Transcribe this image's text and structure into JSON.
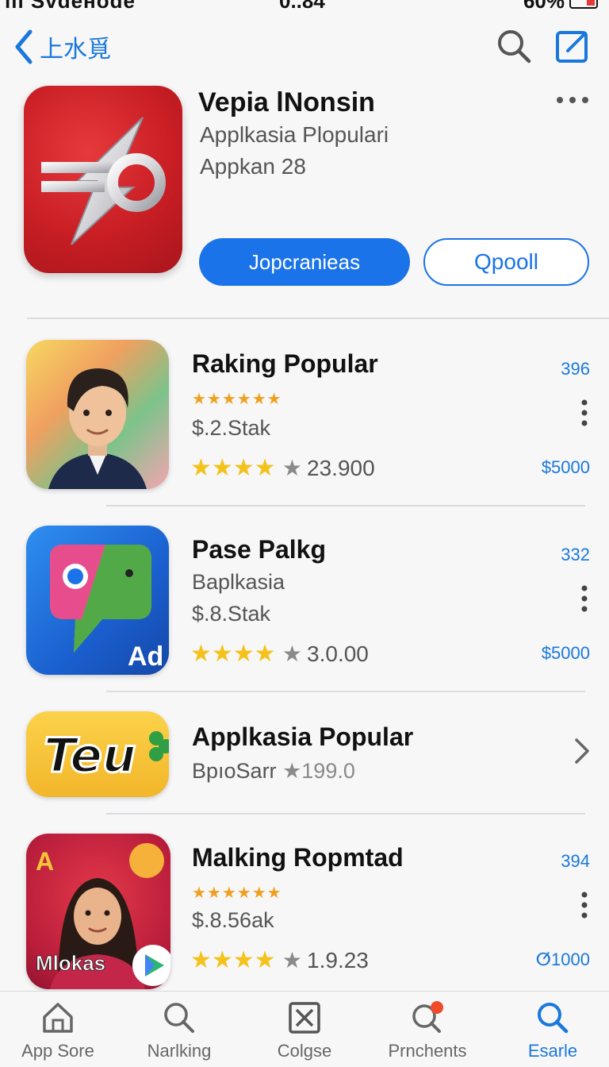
{
  "status_bar": {
    "carrier": "ııı Svdeнode",
    "time": "0..84",
    "battery_text": "60%"
  },
  "nav": {
    "back_label": "上水覓"
  },
  "featured": {
    "title": "Vepia lNonsin",
    "subtitle1": "Applkasia Plopulari",
    "subtitle2": "Appkan 28",
    "primary_button": "Jopcranieas",
    "secondary_button": "Qpooll"
  },
  "apps": [
    {
      "title": "Raking Popular",
      "small_stars": "★★★★★★",
      "price_line": "$.2.Stak",
      "stars": "★★★★",
      "rating_count": "23.900",
      "rank": "396",
      "price": "$5000"
    },
    {
      "title": "Pase Palkg",
      "category": "Baplkasia",
      "price_line": "$.8.Stak",
      "stars": "★★★★",
      "rating_count": "3.0.00",
      "rank": "332",
      "price": "$5000",
      "icon_badge": "Ad"
    },
    {
      "title": "Applkasia Popular",
      "category": "BpıoSarr",
      "rating": "★199.0",
      "icon_text": "Teu"
    },
    {
      "title": "Malking Ropmtad",
      "small_stars": "★★★★★★",
      "price_line": "$.8.56ak",
      "stars": "★★★★",
      "rating_count": "1.9.23",
      "rank": "394",
      "price": "ⵚ1000",
      "icon_letter": "A",
      "icon_text": "Mlokas"
    }
  ],
  "tabs": [
    {
      "label": "App Sore",
      "icon": "app-store-icon"
    },
    {
      "label": "Narlking",
      "icon": "search-icon"
    },
    {
      "label": "Colgse",
      "icon": "close-box-icon"
    },
    {
      "label": "Prnchents",
      "icon": "notification-search-icon"
    },
    {
      "label": "Esarle",
      "icon": "search-icon"
    }
  ],
  "colors": {
    "accent": "#1a78dc",
    "primary_button": "#1a73e8",
    "star": "#f4c21a",
    "notification_dot": "#f04a2a"
  }
}
